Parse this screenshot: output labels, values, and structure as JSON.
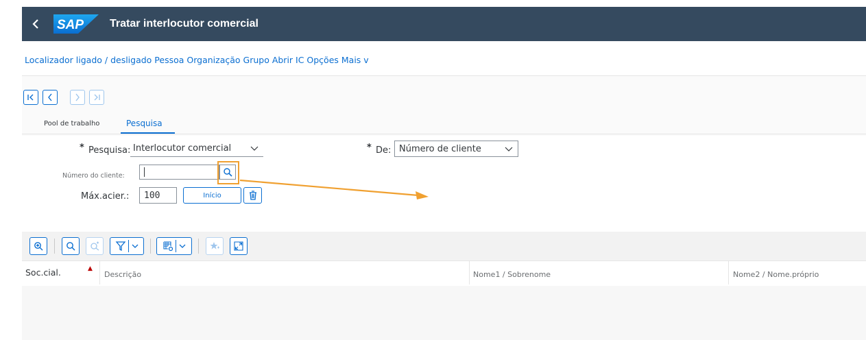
{
  "shell": {
    "logo_text": "SAP",
    "title": "Tratar interlocutor comercial",
    "header_color": "#354a5f"
  },
  "menu": {
    "text": "Localizador ligado / desligado Pessoa Organização Grupo Abrir IC Opções Mais v"
  },
  "tabs": [
    {
      "label": "Pool de trabalho",
      "selected": false
    },
    {
      "label": "Pesquisa",
      "selected": true
    }
  ],
  "search": {
    "search_label": "Pesquisa:",
    "search_value": "Interlocutor comercial",
    "de_label": "De:",
    "de_value": "Número de cliente",
    "customer_label": "Número do cliente:",
    "customer_value": "",
    "max_label": "Máx.acier.:",
    "max_value": "100",
    "start_button": "Início"
  },
  "table": {
    "columns": [
      "Soc.cial.",
      "Descrição",
      "Nome1 / Sobrenome",
      "Nome2 / Nome.próprio"
    ]
  },
  "colors": {
    "accent": "#0a6ed1",
    "required": "#bb0000",
    "annotation": "#f0a030"
  }
}
